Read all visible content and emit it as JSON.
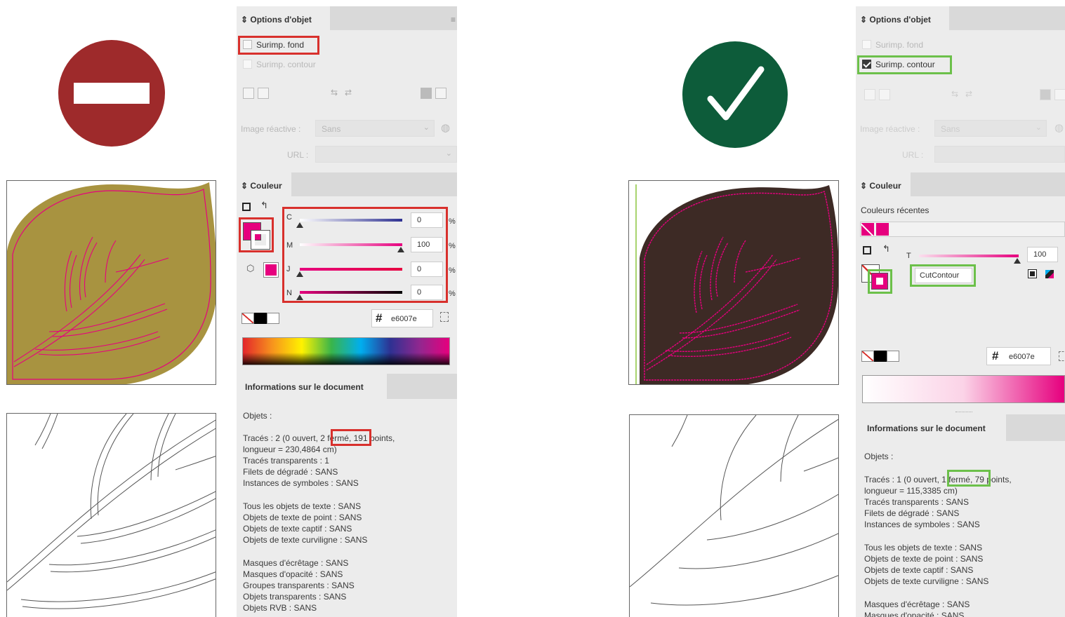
{
  "left_panel": {
    "object_options_title": "Options d'objet",
    "overprint_fill": "Surimp. fond",
    "overprint_stroke": "Surimp. contour",
    "image_reactive_label": "Image réactive :",
    "image_reactive_value": "Sans",
    "url_label": "URL :",
    "color_title": "Couleur",
    "channels": [
      {
        "label": "C",
        "value": "0"
      },
      {
        "label": "M",
        "value": "100"
      },
      {
        "label": "J",
        "value": "0"
      },
      {
        "label": "N",
        "value": "0"
      }
    ],
    "percent": "%",
    "hash": "#",
    "hex": "e6007e",
    "doc_info_title": "Informations sur le document",
    "objects_label": "Objets :",
    "paths_prefix": "Tracés : 2 (0 ouvert, ",
    "paths_highlight": "2 fermé,",
    "paths_suffix": " 191 points,",
    "length_line": "longueur = 230,4864 cm)",
    "info_lines": [
      "Tracés transparents : 1",
      "Filets de dégradé : SANS",
      "Instances de symboles : SANS",
      "",
      "Tous les objets de texte : SANS",
      "Objets de texte de point : SANS",
      "Objets de texte captif : SANS",
      "Objets de texte curviligne : SANS",
      "",
      "Masques d'écrêtage : SANS",
      "Masques d'opacité : SANS",
      "Groupes transparents : SANS",
      "Objets transparents : SANS",
      "Objets RVB : SANS"
    ]
  },
  "right_panel": {
    "object_options_title": "Options d'objet",
    "overprint_fill": "Surimp. fond",
    "overprint_stroke": "Surimp. contour",
    "image_reactive_label": "Image réactive :",
    "image_reactive_value": "Sans",
    "url_label": "URL :",
    "color_title": "Couleur",
    "recent_colors": "Couleurs récentes",
    "tint_label": "T",
    "tint_value": "100",
    "swatch_name": "CutContour",
    "hash": "#",
    "hex": "e6007e",
    "doc_info_title": "Informations sur le document",
    "objects_label": "Objets :",
    "paths_prefix": "Tracés : 1 (0 ouvert, ",
    "paths_highlight": "1 fermé,",
    "paths_suffix": " 79 points,",
    "length_line": "longueur = 115,3385 cm)",
    "info_lines": [
      "Tracés transparents : SANS",
      "Filets de dégradé : SANS",
      "Instances de symboles : SANS",
      "",
      "Tous les objets de texte : SANS",
      "Objets de texte de point : SANS",
      "Objets de texte captif : SANS",
      "Objets de texte curviligne : SANS",
      "",
      "Masques d'écrêtage : SANS",
      "Masques d'opacité : SANS"
    ]
  },
  "icons": {
    "wrong": "no-entry-icon",
    "right": "checkmark-icon"
  },
  "colors": {
    "wrong": "#9e2a2b",
    "right": "#0d5c3a",
    "magenta": "#e6007e",
    "leaf_olive": "#a89340",
    "leaf_brown": "#3d2a25",
    "red_highlight": "#d8302c",
    "green_highlight": "#6cc04a"
  }
}
